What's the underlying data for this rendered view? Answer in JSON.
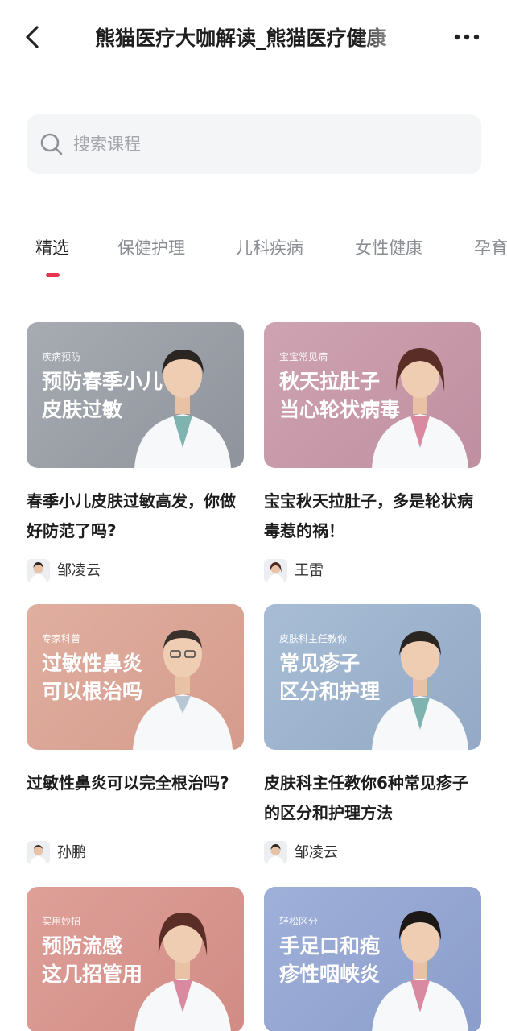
{
  "header": {
    "title": "熊猫医疗大咖解读_熊猫医疗健康",
    "back_icon": "chevron-left-icon",
    "more_icon": "more-horizontal-icon"
  },
  "search": {
    "placeholder": "搜索课程",
    "icon": "search-icon"
  },
  "tabs": [
    {
      "label": "精选",
      "active": true
    },
    {
      "label": "保健护理",
      "active": false
    },
    {
      "label": "儿科疾病",
      "active": false
    },
    {
      "label": "女性健康",
      "active": false
    },
    {
      "label": "孕育",
      "active": false
    }
  ],
  "colors": {
    "accent": "#e8344e",
    "search_bg": "#f4f5f7"
  },
  "courses": [
    {
      "tag": "疾病预防",
      "cover_title": "预防春季小儿\n皮肤过敏",
      "title": "春季小儿皮肤过敏高发，你做好防范了吗?",
      "author": "邹凌云",
      "cover_color": "#9fa3aa"
    },
    {
      "tag": "宝宝常见病",
      "cover_title": "秋天拉肚子\n当心轮状病毒",
      "title": "宝宝秋天拉肚子，多是轮状病毒惹的祸！",
      "author": "王雷",
      "cover_color": "#c99aa8"
    },
    {
      "tag": "专家科普",
      "cover_title": "过敏性鼻炎\n可以根治吗",
      "title": "过敏性鼻炎可以完全根治吗?",
      "author": "孙鹏",
      "cover_color": "#dba596"
    },
    {
      "tag": "皮肤科主任教你",
      "cover_title": "常见疹子\n区分和护理",
      "title": "皮肤科主任教你6种常见疹子的区分和护理方法",
      "author": "邹凌云",
      "cover_color": "#9fb3cc"
    },
    {
      "tag": "实用妙招",
      "cover_title": "预防流感\n这几招管用",
      "title": "",
      "author": "",
      "cover_color": "#d99690"
    },
    {
      "tag": "轻松区分",
      "cover_title": "手足口和疱\n疹性咽峡炎",
      "title": "",
      "author": "",
      "cover_color": "#96a7d2"
    }
  ]
}
